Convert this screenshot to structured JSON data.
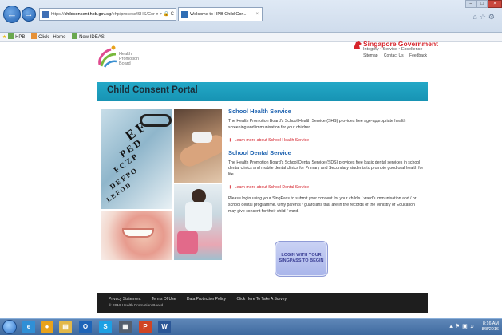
{
  "browser": {
    "url_prefix": "https://",
    "url_domain": "childconsent.hpb.gov.sg",
    "url_rest": "/ehp/process/SHS/Cor",
    "url_tools": "⌕ ▾ 🔒 C",
    "tab_title": "Welcome to HPB Child Con...",
    "tab_close": "×",
    "back_icon": "←",
    "fwd_icon": "→",
    "min": "–",
    "max": "□",
    "close": "×",
    "toolbar_icons": "⌂☆⚙"
  },
  "favorites": [
    {
      "label": "HPB",
      "color": "#6aa84f"
    },
    {
      "label": "Click - Home",
      "color": "#e69138"
    },
    {
      "label": "New IDEAS",
      "color": "#6aa84f"
    }
  ],
  "header": {
    "logo_line1": "Health",
    "logo_line2": "Promotion",
    "logo_line3": "Board",
    "sg_title": "Singapore  Government",
    "sg_tagline": "Integrity • Service • Excellence",
    "links": [
      "Sitemap",
      "Contact Us",
      "Feedback"
    ]
  },
  "banner": {
    "title": "Child Consent Portal"
  },
  "content": {
    "shs_heading": "School Health Service",
    "shs_text": "The Health Promotion Board's School Health Service (SHS) provides free age-appropriate health screening and immunisation for your children.",
    "shs_link": "Learn more about School Health Service",
    "sds_heading": "School Dental Service",
    "sds_text": "The Health Promotion Board's School Dental Service (SDS) provides free basic dental services in school dental clinics and mobile dental clinics for Primary and Secondary students to promote good oral health for life.",
    "sds_link": "Learn more about School Dental Service",
    "login_text": "Please login using your SingPass to submit your consent for your child's / ward's immunisation and / or school dental programme. Only parents / guardians that are in the records of the Ministry of Education may give consent for their child / ward.",
    "login_button_line1": "LOGIN WITH YOUR",
    "login_button_line2": "SINGPASS TO BEGIN",
    "plus": "+"
  },
  "footer": {
    "links": [
      "Privacy Statement",
      "Terms Of Use",
      "Data Protection Policy",
      "Click Here To Take A Survey"
    ],
    "copyright": "© 2016 Health Promotion Board"
  },
  "taskbar": {
    "apps": [
      {
        "icon": "ie-icon",
        "glyph": "e",
        "color": "#2f8fd6"
      },
      {
        "icon": "chrome-icon",
        "glyph": "●",
        "color": "#e8a21b"
      },
      {
        "icon": "explorer-icon",
        "glyph": "▤",
        "color": "#e2b84a"
      },
      {
        "icon": "outlook-icon",
        "glyph": "O",
        "color": "#1e64b8"
      },
      {
        "icon": "skype-icon",
        "glyph": "S",
        "color": "#1da0e4"
      },
      {
        "icon": "photos-icon",
        "glyph": "▦",
        "color": "#555f6e"
      },
      {
        "icon": "powerpoint-icon",
        "glyph": "P",
        "color": "#d04423"
      },
      {
        "icon": "word-icon",
        "glyph": "W",
        "color": "#2b5797"
      }
    ],
    "time": "8:16 AM",
    "date": "8/8/2016",
    "tray_icons": "▴⚑▣♫"
  },
  "colors": {
    "banner": "#1e9fbf",
    "heading": "#1f63b0",
    "link": "#d4202a",
    "footer": "#1e1e1e"
  }
}
